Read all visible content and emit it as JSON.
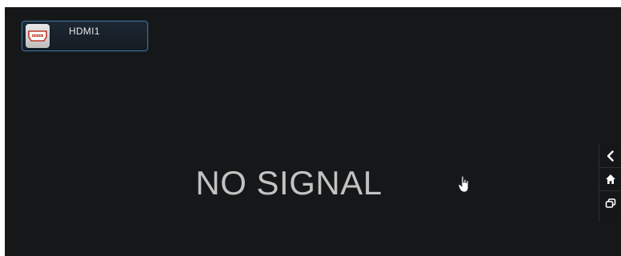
{
  "source": {
    "label": "HDMI1",
    "icon": "hdmi-port-icon",
    "border_color": "#3f6f9b"
  },
  "message": {
    "text": "NO SIGNAL",
    "color": "#c2c2c2"
  },
  "cursor": {
    "icon": "hand-pointer-icon"
  },
  "nav": {
    "items": [
      {
        "name": "back",
        "icon": "chevron-left-icon"
      },
      {
        "name": "home",
        "icon": "home-icon"
      },
      {
        "name": "recent-apps",
        "icon": "recent-apps-icon"
      }
    ]
  },
  "colors": {
    "screen_background": "#151719",
    "page_background": "#ffffff"
  }
}
